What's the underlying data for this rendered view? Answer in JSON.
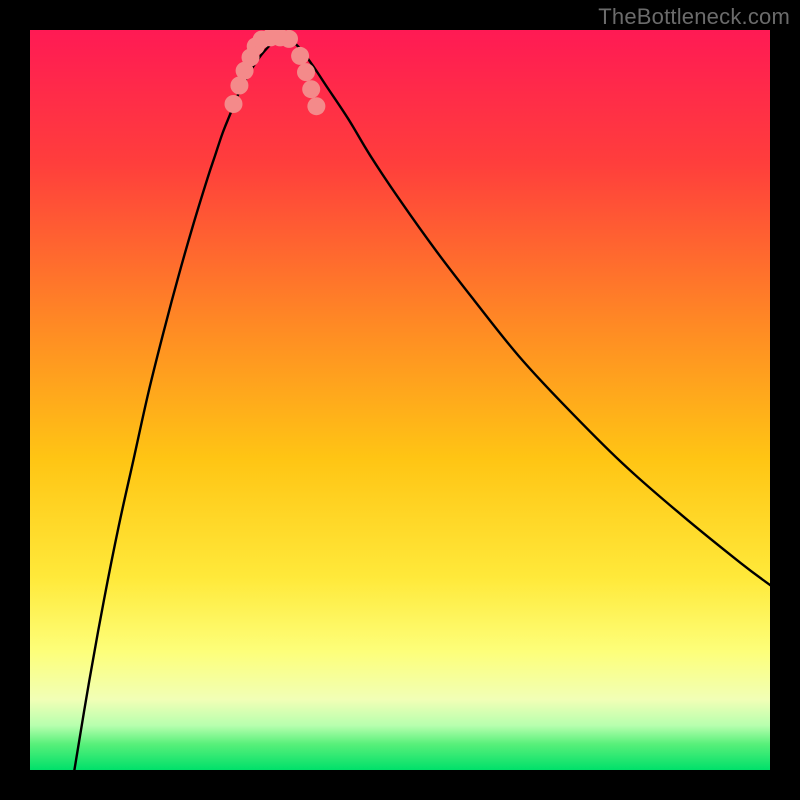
{
  "watermark": "TheBottleneck.com",
  "chart_data": {
    "type": "line",
    "title": "",
    "xlabel": "",
    "ylabel": "",
    "xlim": [
      0,
      100
    ],
    "ylim": [
      0,
      100
    ],
    "grid": false,
    "legend": false,
    "gradient_stops": [
      {
        "offset": 0.0,
        "color": "#ff1a54"
      },
      {
        "offset": 0.18,
        "color": "#ff3e3c"
      },
      {
        "offset": 0.4,
        "color": "#ff8a24"
      },
      {
        "offset": 0.58,
        "color": "#ffc514"
      },
      {
        "offset": 0.74,
        "color": "#ffe93a"
      },
      {
        "offset": 0.84,
        "color": "#fdff7a"
      },
      {
        "offset": 0.905,
        "color": "#f1ffb6"
      },
      {
        "offset": 0.94,
        "color": "#b7ffae"
      },
      {
        "offset": 0.965,
        "color": "#58f07a"
      },
      {
        "offset": 1.0,
        "color": "#00e06a"
      }
    ],
    "optimal_band_y": [
      97.0,
      100.0
    ],
    "series": [
      {
        "name": "bottleneck-curve",
        "color": "#000000",
        "x": [
          6,
          8,
          10,
          12,
          14,
          16,
          18,
          20,
          22,
          24,
          25,
          26,
          27,
          28,
          29,
          30,
          31,
          32,
          33,
          34,
          36,
          38,
          40,
          43,
          46,
          50,
          55,
          60,
          66,
          72,
          80,
          88,
          96,
          100
        ],
        "y": [
          0,
          12,
          23,
          33,
          42,
          51,
          59,
          66.5,
          73.5,
          80,
          83,
          86,
          88.5,
          91,
          93,
          94.8,
          96.3,
          97.5,
          98.5,
          99.2,
          98.0,
          95.5,
          92.5,
          88.0,
          83.0,
          77.0,
          70.0,
          63.5,
          56.0,
          49.5,
          41.5,
          34.5,
          28.0,
          25.0
        ]
      }
    ],
    "markers": {
      "name": "highlight-dots",
      "color": "#f48a8a",
      "radius_px": 9,
      "points": [
        {
          "x": 27.5,
          "y": 90.0
        },
        {
          "x": 28.3,
          "y": 92.5
        },
        {
          "x": 29.0,
          "y": 94.5
        },
        {
          "x": 29.8,
          "y": 96.3
        },
        {
          "x": 30.5,
          "y": 97.8
        },
        {
          "x": 31.3,
          "y": 98.7
        },
        {
          "x": 32.5,
          "y": 99.0
        },
        {
          "x": 33.8,
          "y": 99.0
        },
        {
          "x": 35.0,
          "y": 98.8
        },
        {
          "x": 36.5,
          "y": 96.5
        },
        {
          "x": 37.3,
          "y": 94.3
        },
        {
          "x": 38.0,
          "y": 92.0
        },
        {
          "x": 38.7,
          "y": 89.7
        }
      ]
    }
  }
}
